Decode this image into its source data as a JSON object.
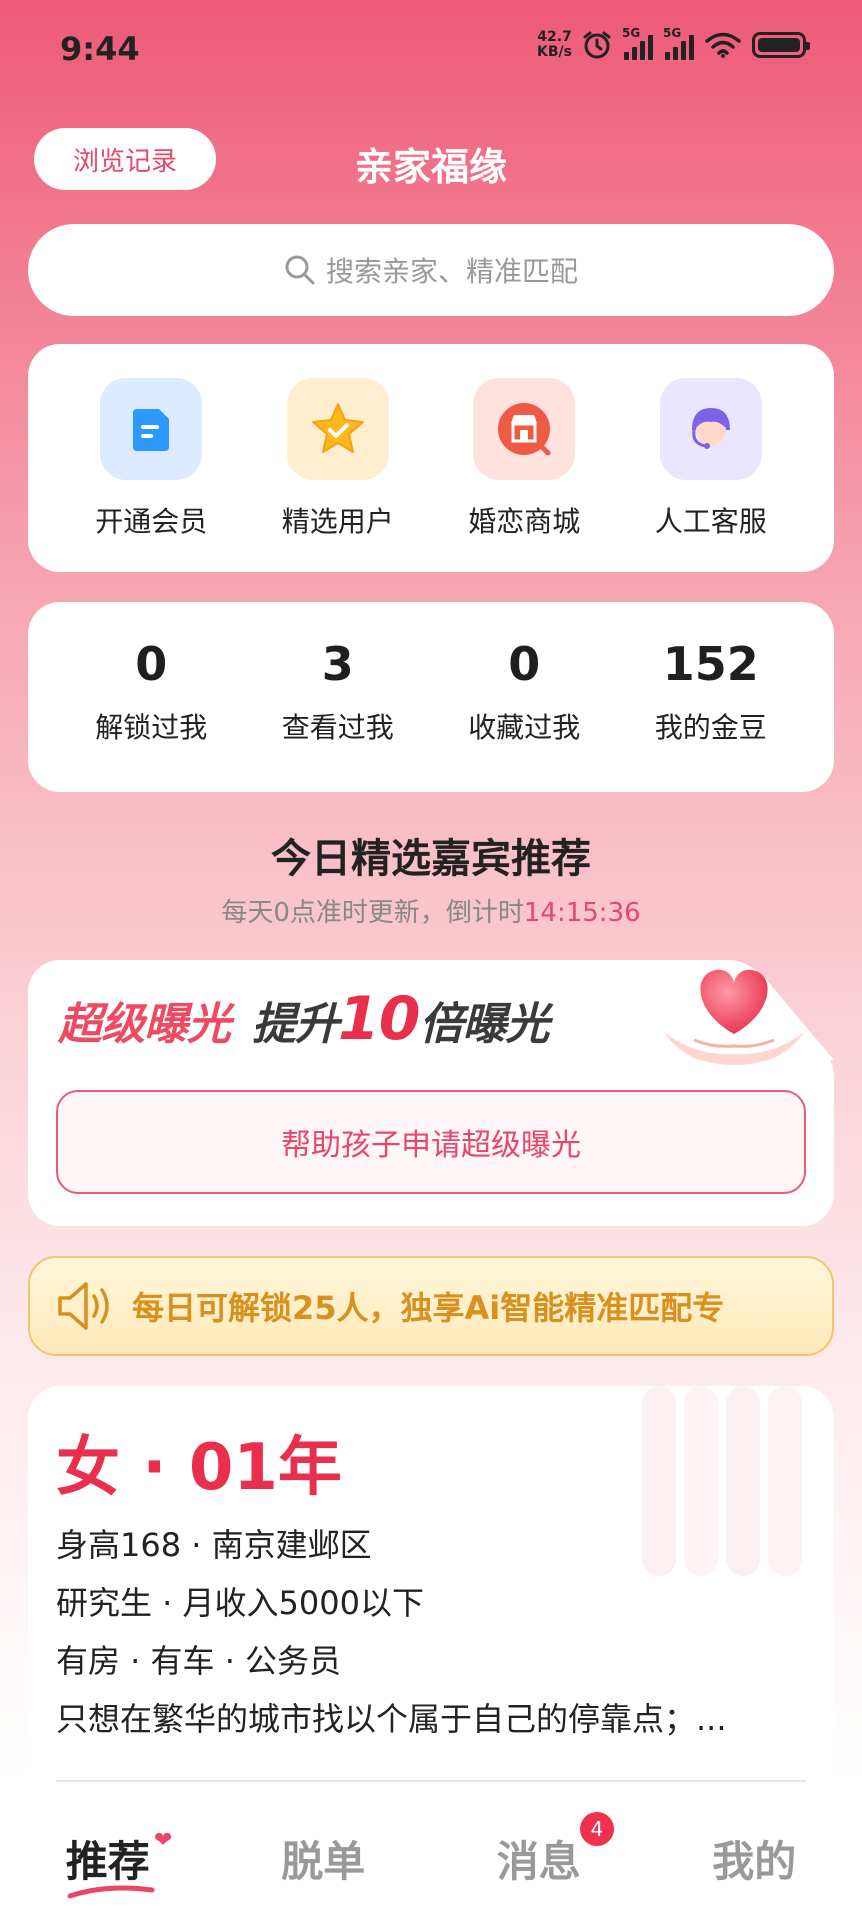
{
  "status_bar": {
    "time": "9:44",
    "net_speed_value": "42.7",
    "net_speed_unit": "KB/s",
    "sim1": "5G",
    "sim2": "5G"
  },
  "header": {
    "history_button": "浏览记录",
    "title": "亲家福缘"
  },
  "search": {
    "placeholder": "搜索亲家、精准匹配"
  },
  "quick_actions": [
    {
      "label": "开通会员",
      "icon": "document-icon",
      "color": "#3aa0ff"
    },
    {
      "label": "精选用户",
      "icon": "star-icon",
      "color": "#ffb81c"
    },
    {
      "label": "婚恋商城",
      "icon": "store-icon",
      "color": "#ef5a45"
    },
    {
      "label": "人工客服",
      "icon": "support-agent-icon",
      "color": "#8a70ee"
    }
  ],
  "stats": [
    {
      "value": "0",
      "label": "解锁过我"
    },
    {
      "value": "3",
      "label": "查看过我"
    },
    {
      "value": "0",
      "label": "收藏过我"
    },
    {
      "value": "152",
      "label": "我的金豆"
    }
  ],
  "recommend": {
    "title": "今日精选嘉宾推荐",
    "subtitle": "每天0点准时更新，倒计时",
    "countdown": "14:15:36"
  },
  "promo": {
    "headline_1": "超级曝光",
    "headline_2_pre": "提升",
    "headline_2_num": "10",
    "headline_2_post": "倍曝光",
    "button": "帮助孩子申请超级曝光"
  },
  "notice": {
    "text": "每日可解锁25人，独享Ai智能精准匹配专"
  },
  "profile": {
    "title": "女 · 01年",
    "lines": [
      "身高168 · 南京建邺区",
      "研究生 · 月收入5000以下",
      "有房 · 有车 · 公务员",
      "只想在繁华的城市找以个属于自己的停靠点；..."
    ]
  },
  "tabs": [
    {
      "label": "推荐",
      "active": true
    },
    {
      "label": "脱单",
      "active": false
    },
    {
      "label": "消息",
      "active": false,
      "badge": "4"
    },
    {
      "label": "我的",
      "active": false
    }
  ],
  "colors": {
    "accent": "#e8476a",
    "gold": "#d8901e"
  }
}
